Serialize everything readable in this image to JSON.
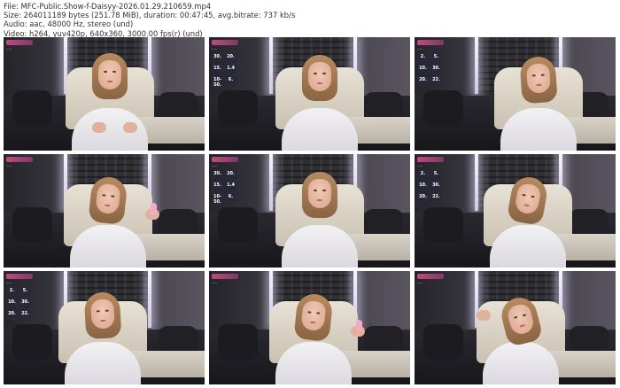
{
  "header": {
    "file": "File: MFC-Public.Show-f-Daisyy-2026.01.29.210659.mp4",
    "size": "Size: 264011189 bytes (251.78 MiB), duration: 00:47:45, avg.bitrate: 737 kb/s",
    "audio": "Audio: aac, 48000 Hz, stereo (und)",
    "video": "Video: h264, yuv420p, 640x360, 3000.00 fps(r) (und)"
  },
  "frames": [
    {
      "id": 1,
      "overlay": "short",
      "pose": "hands-chest",
      "cells": []
    },
    {
      "id": 2,
      "overlay": "tall",
      "pose": "neutral",
      "cells": [
        [
          "30.",
          "20."
        ],
        [
          "15.",
          "1.4"
        ],
        [
          "10-50.",
          "6."
        ]
      ]
    },
    {
      "id": 3,
      "overlay": "tall",
      "pose": "neutral-right",
      "cells": [
        [
          "2.",
          "5."
        ],
        [
          "10.",
          "30."
        ],
        [
          "20.",
          "22."
        ]
      ]
    },
    {
      "id": 4,
      "overlay": "short",
      "pose": "holding-prop",
      "cells": []
    },
    {
      "id": 5,
      "overlay": "tall",
      "pose": "neutral",
      "cells": [
        [
          "30.",
          "20."
        ],
        [
          "15.",
          "1.4"
        ],
        [
          "10-50.",
          "6."
        ]
      ]
    },
    {
      "id": 6,
      "overlay": "tall",
      "pose": "tilted",
      "cells": [
        [
          "2.",
          "5."
        ],
        [
          "10.",
          "30."
        ],
        [
          "20.",
          "22."
        ]
      ]
    },
    {
      "id": 7,
      "overlay": "tall",
      "pose": "neutral-left",
      "cells": [
        [
          "2.",
          "5."
        ],
        [
          "10.",
          "30."
        ],
        [
          "20.",
          "22."
        ]
      ]
    },
    {
      "id": 8,
      "overlay": "short",
      "pose": "holding-prop",
      "cells": []
    },
    {
      "id": 9,
      "overlay": "short",
      "pose": "hand-hair",
      "cells": []
    }
  ]
}
